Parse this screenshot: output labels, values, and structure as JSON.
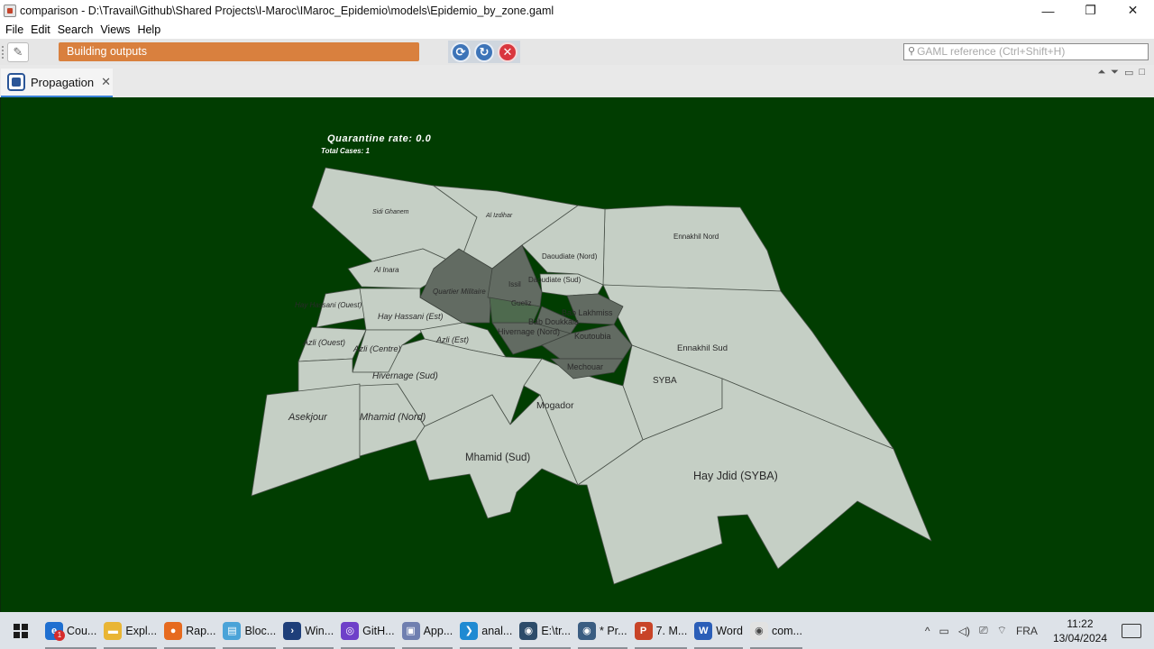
{
  "window": {
    "title": "comparison - D:\\Travail\\Github\\Shared Projects\\I-Maroc\\IMaroc_Epidemio\\models\\Epidemio_by_zone.gaml",
    "minimize": "—",
    "restore": "❐",
    "close": "✕"
  },
  "menu": {
    "items": [
      "File",
      "Edit",
      "Search",
      "Views",
      "Help"
    ]
  },
  "toolbar": {
    "status": "Building outputs",
    "gaml_placeholder": "GAML reference (Ctrl+Shift+H)",
    "controls": {
      "reload_icon": "reload-icon",
      "step_icon": "step-icon",
      "stop_icon": "stop-icon"
    },
    "colors": {
      "status_bg": "#d9803e",
      "control_blue": "#3d74b8",
      "control_red": "#d9363e"
    }
  },
  "tab": {
    "label": "Propagation",
    "close": "✕"
  },
  "display": {
    "background": "#013d01",
    "quarantine_label": "Quarantine rate: 0.0",
    "cases_label": "Total Cases: 1",
    "colors": {
      "zone_healthy": "#c5cfc5",
      "zone_infected": "#626b62",
      "zone_infected_strong": "#4e6a4e"
    },
    "zones": [
      {
        "key": "sidi_ghanem",
        "label": "Sidi Ghanem",
        "state": "healthy"
      },
      {
        "key": "al_izdihar",
        "label": "Al Izdihar",
        "state": "healthy"
      },
      {
        "key": "ennakhil_nord",
        "label": "Ennakhil Nord",
        "state": "healthy"
      },
      {
        "key": "daoudiate_nord",
        "label": "Daoudiate (Nord)",
        "state": "healthy"
      },
      {
        "key": "al_inara",
        "label": "Al Inara",
        "state": "healthy"
      },
      {
        "key": "issil",
        "label": "Issil",
        "state": "infected"
      },
      {
        "key": "daoudiate_sud",
        "label": "Daoudiate (Sud)",
        "state": "healthy"
      },
      {
        "key": "quartier_militaire",
        "label": "Quartier Militaire",
        "state": "infected"
      },
      {
        "key": "hay_hassani_ouest",
        "label": "Hay Hassani (Ouest)",
        "state": "healthy"
      },
      {
        "key": "gueliz",
        "label": "Gueliz",
        "state": "infected_strong"
      },
      {
        "key": "hay_hassani_est",
        "label": "Hay Hassani (Est)",
        "state": "healthy"
      },
      {
        "key": "bab_lakhmiss",
        "label": "Bab Lakhmiss",
        "state": "infected"
      },
      {
        "key": "bab_doukkala",
        "label": "Bab Doukkala",
        "state": "infected"
      },
      {
        "key": "hivernage_nord",
        "label": "Hivernage (Nord)",
        "state": "infected"
      },
      {
        "key": "koutoubia",
        "label": "Koutoubia",
        "state": "infected"
      },
      {
        "key": "azli_ouest",
        "label": "Azli (Ouest)",
        "state": "healthy"
      },
      {
        "key": "azli_est",
        "label": "Azli (Est)",
        "state": "healthy"
      },
      {
        "key": "azli_centre",
        "label": "Azli (Centre)",
        "state": "healthy"
      },
      {
        "key": "ennakhil_sud",
        "label": "Ennakhil Sud",
        "state": "healthy"
      },
      {
        "key": "mechouar",
        "label": "Mechouar",
        "state": "infected"
      },
      {
        "key": "hivernage_sud",
        "label": "Hivernage (Sud)",
        "state": "healthy"
      },
      {
        "key": "syba",
        "label": "SYBA",
        "state": "healthy"
      },
      {
        "key": "mogador",
        "label": "Mogador",
        "state": "healthy"
      },
      {
        "key": "asekjour",
        "label": "Asekjour",
        "state": "healthy"
      },
      {
        "key": "mhamid_nord",
        "label": "Mhamid (Nord)",
        "state": "healthy"
      },
      {
        "key": "mhamid_sud",
        "label": "Mhamid (Sud)",
        "state": "healthy"
      },
      {
        "key": "hay_jdid_syba",
        "label": "Hay Jdid (SYBA)",
        "state": "healthy"
      }
    ]
  },
  "taskbar": {
    "apps": [
      {
        "key": "cou",
        "label": "Cou...",
        "icon": "edge-icon",
        "color": "#1f6fd0",
        "badge": "1"
      },
      {
        "key": "expl",
        "label": "Expl...",
        "icon": "folder-icon",
        "color": "#e9b534"
      },
      {
        "key": "rap",
        "label": "Rap...",
        "icon": "firefox-icon",
        "color": "#e66a1f"
      },
      {
        "key": "bloc",
        "label": "Bloc...",
        "icon": "notepad-icon",
        "color": "#4aa3d8"
      },
      {
        "key": "win",
        "label": "Win...",
        "icon": "powershell-icon",
        "color": "#1e3f7a"
      },
      {
        "key": "gith",
        "label": "GitH...",
        "icon": "github-icon",
        "color": "#6e40c9"
      },
      {
        "key": "app",
        "label": "App...",
        "icon": "pdf-icon",
        "color": "#6f7fb0"
      },
      {
        "key": "anal",
        "label": "anal...",
        "icon": "vscode-icon",
        "color": "#1f8ad2"
      },
      {
        "key": "etr",
        "label": "E:\\tr...",
        "icon": "gama-icon",
        "color": "#2d4c6a"
      },
      {
        "key": "pr",
        "label": "* Pr...",
        "icon": "gama-icon",
        "color": "#3a5d82"
      },
      {
        "key": "powerpoint",
        "label": "7. M...",
        "icon": "powerpoint-icon",
        "color": "#c84428"
      },
      {
        "key": "word",
        "label": "Word",
        "icon": "word-icon",
        "color": "#2b5eb8"
      },
      {
        "key": "com",
        "label": "com...",
        "icon": "gama-icon",
        "color": "#e2e2e2"
      }
    ],
    "tray": {
      "language": "FRA",
      "time": "11:22",
      "date": "13/04/2024"
    }
  }
}
